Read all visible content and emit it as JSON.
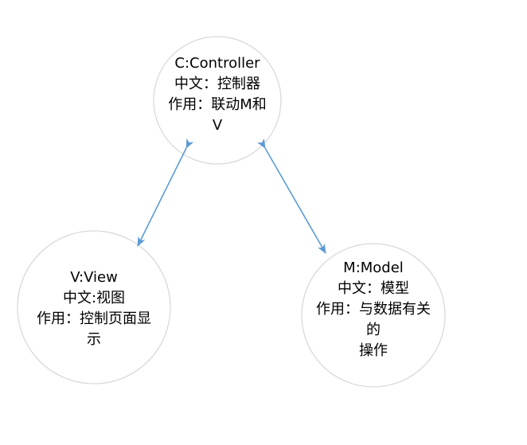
{
  "nodes": {
    "controller": {
      "lines": [
        "C:Controller",
        "中文：控制器",
        "作用：联动M和",
        "V"
      ]
    },
    "view": {
      "lines": [
        "V:View",
        "中文:视图",
        "作用：控制页面显",
        "示"
      ]
    },
    "model": {
      "lines": [
        "M:Model",
        "中文：模型",
        "作用：与数据有关",
        "的",
        "操作"
      ]
    }
  },
  "edges": [
    {
      "from": "controller",
      "to": "view",
      "direction": "both"
    },
    {
      "from": "controller",
      "to": "model",
      "direction": "both"
    }
  ],
  "colors": {
    "node_border": "#d9d9d9",
    "node_fill": "#ffffff",
    "edge": "#5b9bd5",
    "text": "#000000"
  }
}
